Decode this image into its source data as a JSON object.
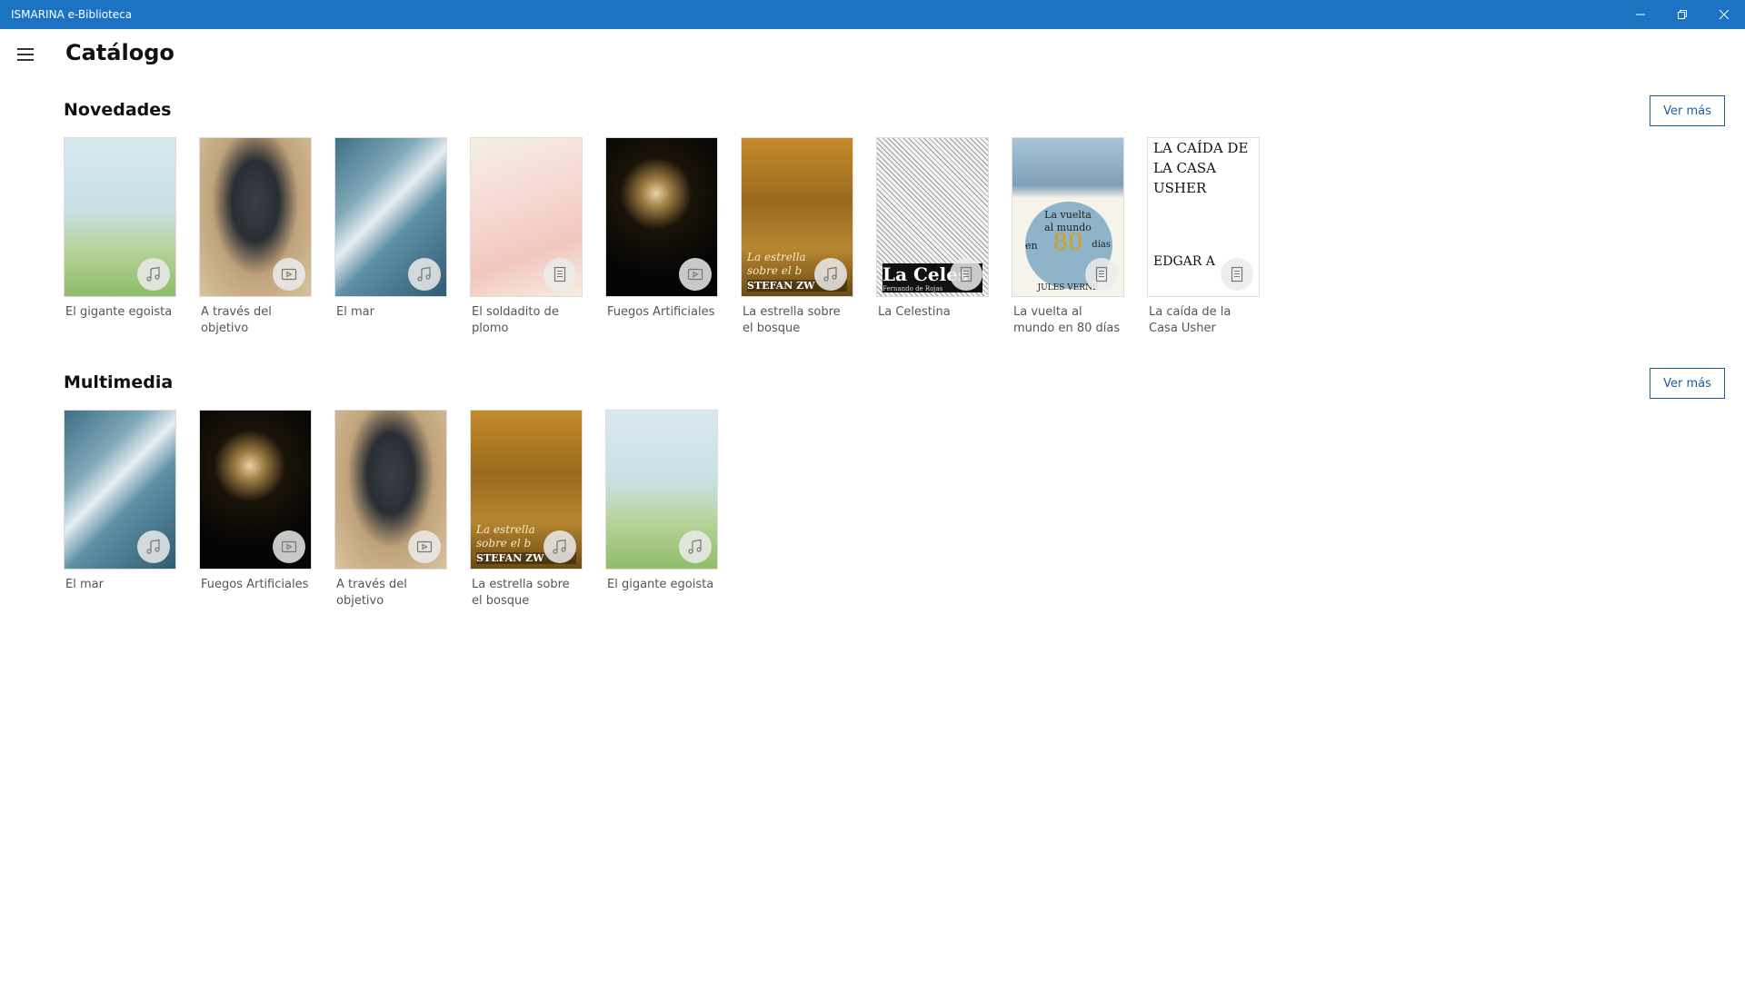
{
  "window": {
    "title": "ISMARINA e-Biblioteca"
  },
  "header": {
    "title": "Catálogo"
  },
  "sections": [
    {
      "title": "Novedades",
      "more_label": "Ver más",
      "items": [
        {
          "label": "El gigante egoista",
          "type": "audio",
          "art": "art-giant"
        },
        {
          "label": "A través del objetivo",
          "type": "video",
          "art": "art-camera"
        },
        {
          "label": "El mar",
          "type": "audio",
          "art": "art-sea"
        },
        {
          "label": "El soldadito de plomo",
          "type": "document",
          "art": "art-soldier"
        },
        {
          "label": "Fuegos Artificiales",
          "type": "video",
          "art": "art-fireworks"
        },
        {
          "label": "La estrella sobre el bosque",
          "type": "audio",
          "art": "art-star",
          "cover_text": [
            "La estrella",
            "sobre el b",
            "STEFAN ZW"
          ]
        },
        {
          "label": "La Celestina",
          "type": "document",
          "art": "art-celestina",
          "cover_text": [
            "La Celes",
            "Fernando de Rojas"
          ]
        },
        {
          "label": "La vuelta al mundo en 80 días",
          "type": "document",
          "art": "art-vuelta",
          "cover_text": [
            "La vuelta",
            "al mundo",
            "en",
            "80",
            "días",
            "JULES VERNE"
          ]
        },
        {
          "label": "La caída de la Casa Usher",
          "type": "document",
          "art": "art-usher",
          "cover_text": [
            "LA CAÍDA DE",
            "LA CASA",
            "USHER",
            "EDGAR A"
          ]
        }
      ]
    },
    {
      "title": "Multimedia",
      "more_label": "Ver más",
      "items": [
        {
          "label": "El mar",
          "type": "audio",
          "art": "art-sea"
        },
        {
          "label": "Fuegos Artificiales",
          "type": "video",
          "art": "art-fireworks"
        },
        {
          "label": "A través del objetivo",
          "type": "video",
          "art": "art-camera"
        },
        {
          "label": "La estrella sobre el bosque",
          "type": "audio",
          "art": "art-star",
          "cover_text": [
            "La estrella",
            "sobre el b",
            "STEFAN ZW"
          ]
        },
        {
          "label": "El gigante egoista",
          "type": "audio",
          "art": "art-giant"
        }
      ]
    }
  ],
  "icons": {
    "audio": "music-note-icon",
    "video": "play-video-icon",
    "document": "document-icon"
  },
  "colors": {
    "titlebar": "#1b73c2",
    "accent": "#1b5ea3"
  }
}
